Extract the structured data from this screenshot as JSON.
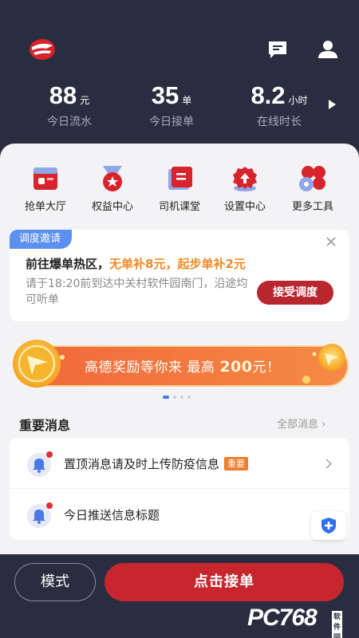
{
  "header": {
    "stats": [
      {
        "value": "88",
        "unit": "元",
        "label": "今日流水"
      },
      {
        "value": "35",
        "unit": "单",
        "label": "今日接单"
      },
      {
        "value": "8.2",
        "unit": "小时",
        "label": "在线时长"
      }
    ],
    "icons": [
      "logo-icon",
      "message-icon",
      "user-icon",
      "arrow-right-icon"
    ]
  },
  "quick_actions": [
    {
      "label": "抢单大厅",
      "icon": "order-hall-icon"
    },
    {
      "label": "权益中心",
      "icon": "medal-icon"
    },
    {
      "label": "司机课堂",
      "icon": "book-icon"
    },
    {
      "label": "设置中心",
      "icon": "gear-icon"
    },
    {
      "label": "更多工具",
      "icon": "tools-icon"
    }
  ],
  "dispatch": {
    "tag": "调度邀请",
    "title_prefix": "前往爆单热区，",
    "title_highlight": "无单补8元，起步单补2元",
    "desc": "请于18:20前到达中关村软件园南门，沿途均可听单",
    "button": "接受调度"
  },
  "banner": {
    "text": "高德奖励等你来 最高",
    "amount": "200",
    "suffix": "元！",
    "dots": 4,
    "active_dot": 0
  },
  "messages": {
    "title": "重要消息",
    "all_label": "全部消息",
    "items": [
      {
        "text": "置顶消息请及时上传防疫信息",
        "badge": "重要"
      },
      {
        "text": "今日推送信息标题",
        "badge": ""
      }
    ]
  },
  "bottom": {
    "mode_label": "模式",
    "take_label": "点击接单"
  },
  "watermark": {
    "text": "PC768",
    "sub": "软件园"
  },
  "colors": {
    "header_bg": "#2a2d40",
    "accent_red": "#c8262f",
    "highlight_orange": "#f08a24",
    "tag_blue": "#5b8ff0"
  }
}
